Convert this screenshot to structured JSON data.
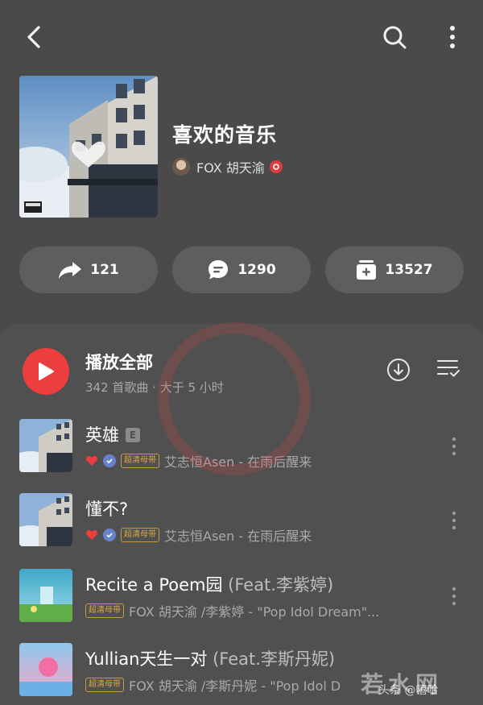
{
  "header": {
    "playlist_title": "喜欢的音乐",
    "creator_name": "FOX 胡天渝"
  },
  "actions": [
    {
      "icon": "share-icon",
      "label": "121"
    },
    {
      "icon": "comment-icon",
      "label": "1290"
    },
    {
      "icon": "collect-icon",
      "label": "13527"
    }
  ],
  "play_all": {
    "title": "播放全部",
    "subtitle": "342 首歌曲 · 大于 5 小时"
  },
  "songs": [
    {
      "title": "英雄",
      "feat": "",
      "explicit": "E",
      "liked": true,
      "verified": true,
      "quality": "超清母带",
      "artist_album": "艾志恒Asen - 在雨后醒来"
    },
    {
      "title": "懂不?",
      "feat": "",
      "explicit": "",
      "liked": true,
      "verified": true,
      "quality": "超清母带",
      "artist_album": "艾志恒Asen - 在雨后醒来"
    },
    {
      "title": "Recite a Poem园",
      "feat": " (Feat.李紫婷)",
      "explicit": "",
      "liked": false,
      "verified": false,
      "quality": "超清母带",
      "artist_album": "FOX 胡天渝 /李紫婷 - \"Pop Idol Dream\"..."
    },
    {
      "title": "Yullian天生一对",
      "feat": " (Feat.李斯丹妮)",
      "explicit": "",
      "liked": false,
      "verified": false,
      "quality": "超清母带",
      "artist_album": "FOX 胡天渝 /李斯丹妮 - \"Pop Idol D"
    }
  ],
  "watermark": {
    "bottom": "若水网",
    "credit": "头条 @嘻哈"
  },
  "colors": {
    "background": "#4a4a4a",
    "accent_red": "#ec3e3e",
    "quality_gold": "#d9a845"
  }
}
